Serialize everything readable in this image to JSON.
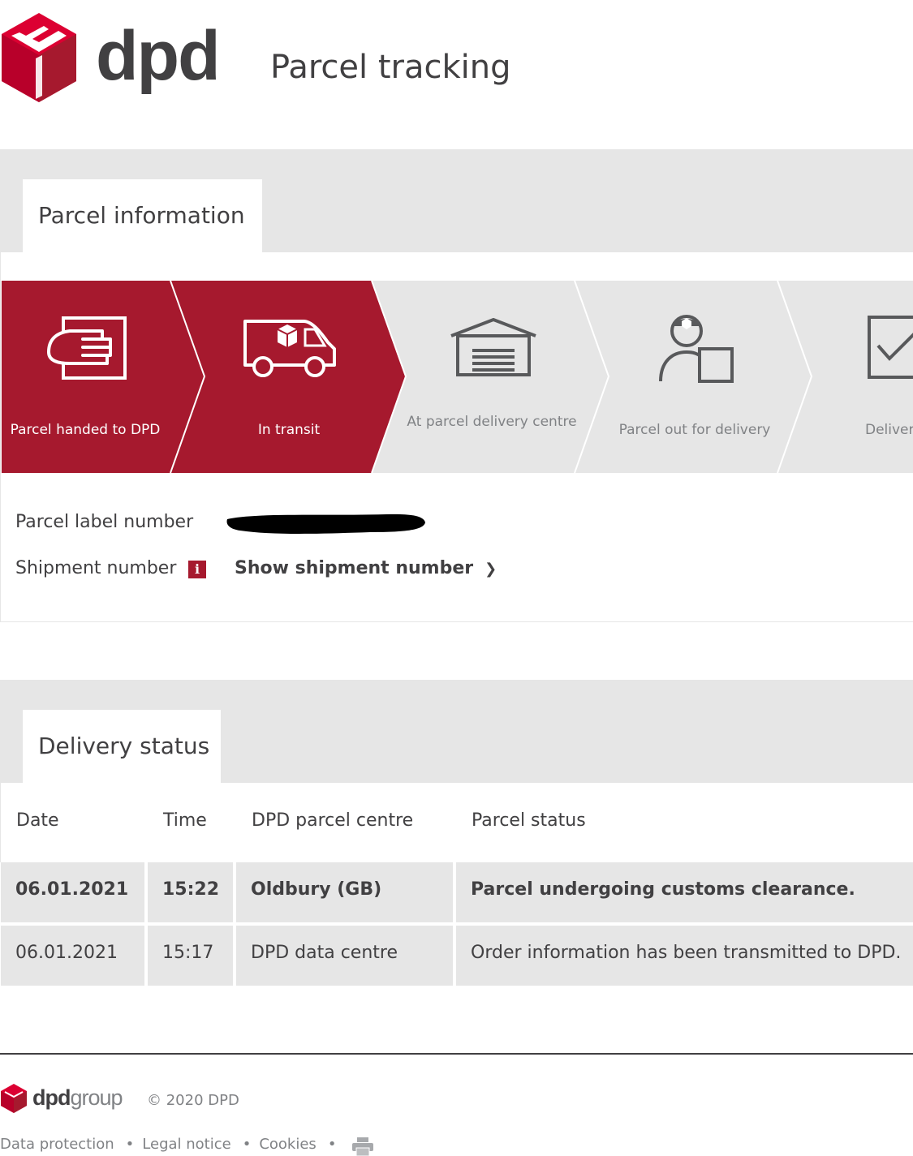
{
  "header": {
    "logo_text": "dpd",
    "title": "Parcel tracking"
  },
  "parcel_info": {
    "tab_label": "Parcel information",
    "steps": [
      {
        "label": "Parcel handed to DPD",
        "active": true,
        "icon": "hand-document-icon"
      },
      {
        "label": "In transit",
        "active": true,
        "icon": "delivery-van-icon"
      },
      {
        "label": "At parcel delivery centre",
        "active": false,
        "icon": "warehouse-icon"
      },
      {
        "label": "Parcel out for delivery",
        "active": false,
        "icon": "courier-icon"
      },
      {
        "label": "Deliver",
        "active": false,
        "icon": "checkbox-icon"
      }
    ],
    "label_number_label": "Parcel label number",
    "shipment_number_label": "Shipment number",
    "info_badge": "i",
    "show_shipment_link": "Show shipment number",
    "chevron": "❯"
  },
  "delivery_status": {
    "tab_label": "Delivery status",
    "columns": [
      "Date",
      "Time",
      "DPD parcel centre",
      "Parcel status"
    ],
    "rows": [
      {
        "date": "06.01.2021",
        "time": "15:22",
        "centre": "Oldbury (GB)",
        "status": "Parcel undergoing customs clearance."
      },
      {
        "date": "06.01.2021",
        "time": "15:17",
        "centre": "DPD data centre",
        "status": "Order information has been transmitted to DPD."
      }
    ]
  },
  "footer": {
    "brand_dpd": "dpd",
    "brand_group": "group",
    "copyright": "© 2020 DPD",
    "links": [
      "Data protection",
      "Legal notice",
      "Cookies"
    ],
    "separator": "•"
  },
  "colors": {
    "brand_red": "#a6192e",
    "text": "#414042",
    "muted": "#808285",
    "band": "#e6e6e6"
  }
}
